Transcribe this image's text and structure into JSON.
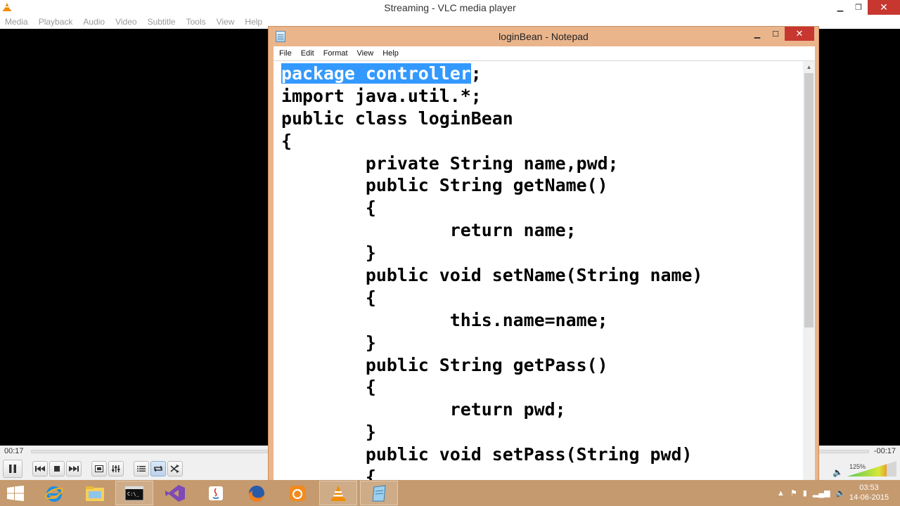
{
  "vlc": {
    "title": "Streaming - VLC media player",
    "menu": [
      "Media",
      "Playback",
      "Audio",
      "Video",
      "Subtitle",
      "Tools",
      "View",
      "Help"
    ],
    "time_elapsed": "00:17",
    "time_remaining": "-00:17",
    "progress_fraction": 0.0,
    "volume_label": "125%",
    "volume_level_percent": 125,
    "controls": {
      "pause_icon": "pause-icon",
      "previous_icon": "previous-icon",
      "stop_icon": "stop-icon",
      "next_icon": "next-icon",
      "fullscreen_icon": "fullscreen-icon",
      "extended_settings_icon": "equalizer-icon",
      "playlist_icon": "playlist-icon",
      "loop_icon": "loop-icon",
      "shuffle_icon": "shuffle-icon"
    }
  },
  "notepad": {
    "title": "loginBean - Notepad",
    "menu": [
      "File",
      "Edit",
      "Format",
      "View",
      "Help"
    ],
    "selected_text": "package controller",
    "lines": [
      ";",
      "import java.util.*;",
      "public class loginBean",
      "{",
      "        private String name,pwd;",
      "        public String getName()",
      "        {",
      "                return name;",
      "        }",
      "        public void setName(String name)",
      "        {",
      "                this.name=name;",
      "        }",
      "        public String getPass()",
      "        {",
      "                return pwd;",
      "        }",
      "        public void setPass(String pwd)",
      "        {"
    ]
  },
  "taskbar": {
    "items": [
      "start-button",
      "internet-explorer-icon",
      "file-explorer-icon",
      "command-prompt-icon",
      "visual-studio-icon",
      "java-icon",
      "firefox-icon",
      "uc-browser-icon",
      "vlc-icon",
      "notepad-icon"
    ],
    "clock_time": "03:53",
    "clock_date": "14-06-2015"
  },
  "colors": {
    "vlc_orange": "#f28c00",
    "selection_blue": "#3399ff",
    "notepad_frame": "#ebb58c",
    "taskbar": "#c59a6e",
    "close_red": "#c7372f"
  }
}
